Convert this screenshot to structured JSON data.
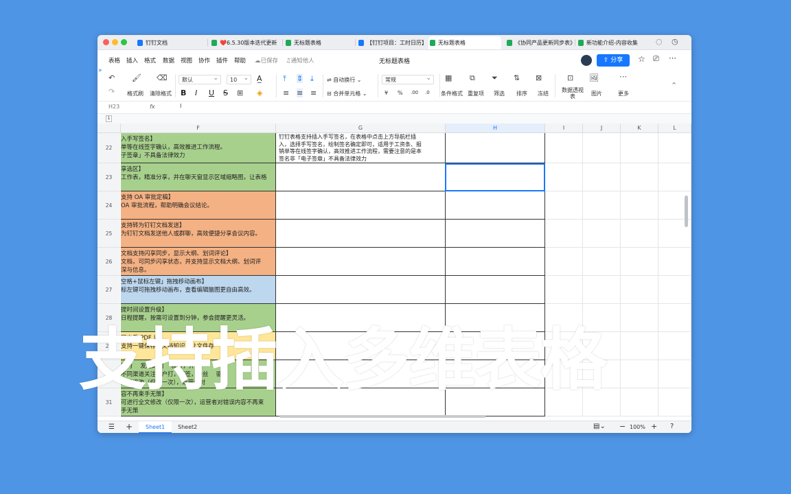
{
  "tabs": [
    {
      "label": "钉钉文档",
      "color": "#1677ff"
    },
    {
      "label": "❤️6.5.30版本迭代更新",
      "color": "#1faa59"
    },
    {
      "label": "无标题表格",
      "color": "#1faa59"
    },
    {
      "label": "【钉钉项目：工时日历】",
      "color": "#1677ff"
    },
    {
      "label": "无标题表格",
      "color": "#1faa59"
    },
    {
      "label": "《协同产品更新同步表》",
      "color": "#1faa59"
    },
    {
      "label": "新功能介绍-内容收集",
      "color": "#1faa59"
    }
  ],
  "menu": [
    "表格",
    "插入",
    "格式",
    "数据",
    "视图",
    "协作",
    "插件",
    "帮助"
  ],
  "status": {
    "saved": "已保存",
    "notify": "通知他人"
  },
  "doc_title": "无标题表格",
  "share_label": "分享",
  "toolbar": {
    "format_painter": "格式刷",
    "clear_format": "清除格式",
    "font_name": "默认",
    "font_size": "10",
    "wrap": "自动换行",
    "merge": "合并单元格",
    "number_format": "常规",
    "conditional": "条件格式",
    "duplicates": "重复项",
    "filter": "筛选",
    "sort": "排序",
    "freeze": "冻结",
    "pivot": "数据透视表",
    "image": "图片",
    "more": "更多",
    "currency": "¥",
    "percent": "%",
    "dec_less": ".00",
    "dec_more": ".0"
  },
  "formula_bar": {
    "cell_ref": "H23",
    "fx": "fx"
  },
  "columns": [
    "F",
    "G",
    "H",
    "I",
    "J",
    "K",
    "L"
  ],
  "freeze_row": "1",
  "rows": [
    {
      "num": "22",
      "f": [
        "入手写签名】",
        "单等在线签字确认，高效推进工作流程。",
        "子签章」不具备法律效力"
      ],
      "g": [
        "钉钉表格支持插入手写签名，在表格中点击上方导航栏插",
        "入，选择手写签名，绘制签名确定即可，适用于工资条、报",
        "销单等在线签字确认，高效推进工作流程，需要注意的是本",
        "签名非「电子签章」不具备法律效力"
      ],
      "color": "#a8d08d"
    },
    {
      "num": "23",
      "f": [
        "享选区】",
        "工作表，精准分享，并在聊天窗显示区域缩略图，让表格"
      ],
      "g": [],
      "color": "#a8d08d"
    },
    {
      "num": "24",
      "f": [
        "支持 OA 审批定稿】",
        "OA 审批流程，帮助明确会议结论。"
      ],
      "g": [],
      "color": "#f4b183"
    },
    {
      "num": "25",
      "f": [
        "支持转为钉钉文档发送】",
        "为钉钉文档发送他人或群聊，高效便捷分享会议内容。"
      ],
      "g": [],
      "color": "#f4b183"
    },
    {
      "num": "26",
      "f": [
        "文档支持闪享同步，显示大纲、划词评论】",
        "文档，可同步闪享状态，并支持显示文档大纲、划词评",
        "深与信息。"
      ],
      "g": [],
      "color": "#f4b183"
    },
    {
      "num": "27",
      "f": [
        "空格+鼠标左键」拖拽移动画布】",
        "标左键可拖拽移动画布，查看编辑脑图更自由高效。"
      ],
      "g": [],
      "color": "#bdd7ee"
    },
    {
      "num": "28",
      "f": [
        "提时间设置升级】",
        "日程提醒，按需可设置到分钟，参会提醒更灵活。"
      ],
      "g": [],
      "color": "#a8d08d"
    },
    {
      "num": "29",
      "f": [
        "可查看 PDF 识",
        "支持一键保存到文档知识，让文件存"
      ],
      "g": [],
      "color": "#ffe699"
    },
    {
      "num": "30",
      "f": [
        "可为 　发送的图 　就打，开",
        "不同渠道关注用户打，打签，粉丝 　驱",
        "进行修改（仅限一次），运营者对"
      ],
      "g": [],
      "color": "#a8d08d"
    },
    {
      "num": "31",
      "f": [
        "容不再束手无策】",
        "可进行全文修改（仅限一次），运营者对错误内容不再束",
        "手无策"
      ],
      "g": [],
      "color": "#a8d08d"
    }
  ],
  "sheets": [
    "Sheet1",
    "Sheet2"
  ],
  "zoom": "100%",
  "overlay_text": "支持插入多维表格"
}
